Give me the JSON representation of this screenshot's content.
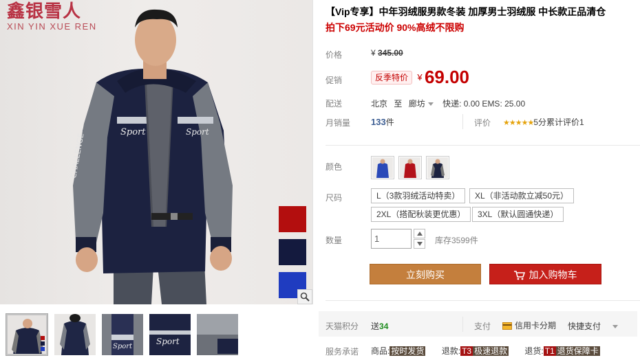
{
  "brand": {
    "name_cn": "鑫银雪人",
    "name_en": "XIN YIN XUE REN"
  },
  "product": {
    "title": "【Vip专享】中年羽绒服男款冬装 加厚男士羽绒服 中长款正品清仓",
    "subtitle": "拍下69元活动价 90%高绒不限购"
  },
  "price": {
    "label": "价格",
    "currency": "¥",
    "original": "345.00"
  },
  "promo": {
    "label": "促销",
    "tag": "反季特价",
    "currency": "¥",
    "price": "69.00"
  },
  "shipping": {
    "label": "配送",
    "from": "北京",
    "to_word": "至",
    "dest": "廊坊",
    "fees": "快递: 0.00 EMS: 25.00"
  },
  "sales": {
    "label": "月销量",
    "count": "133",
    "unit": "件",
    "review_label": "评价",
    "stars": "★★★★★",
    "rating_text": "5分累计评价1"
  },
  "color": {
    "label": "颜色",
    "options": [
      "blue-jacket",
      "red-jacket",
      "navy-jacket"
    ]
  },
  "size": {
    "label": "尺码",
    "options": [
      "L（3款羽绒活动特卖）",
      "XL（非活动款立减50元）",
      "2XL（搭配秋装更优惠）",
      "3XL（默认圆通快递）"
    ]
  },
  "quantity": {
    "label": "数量",
    "value": "1",
    "stock": "库存3599件"
  },
  "actions": {
    "buy": "立刻购买",
    "cart": "加入购物车"
  },
  "points": {
    "label": "天猫积分",
    "text": "送",
    "value": "34"
  },
  "payment": {
    "label": "支付",
    "credit": "信用卡分期",
    "quick": "快捷支付"
  },
  "service": {
    "label": "服务承诺",
    "items": [
      {
        "prefix": "商品:",
        "tag": "按时发货"
      },
      {
        "prefix": "退款:",
        "code": "T3",
        "tag": "极速退款"
      },
      {
        "prefix": "退货:",
        "code": "T1",
        "tag": "退货保障卡"
      }
    ]
  },
  "colors": {
    "accent_red": "#c40000",
    "buy_button": "#c47f3d",
    "cart_button": "#c6201a",
    "brand_red": "#b83244"
  },
  "swatches": [
    "#b30e0e",
    "#141a3e",
    "#1f3cc0"
  ]
}
